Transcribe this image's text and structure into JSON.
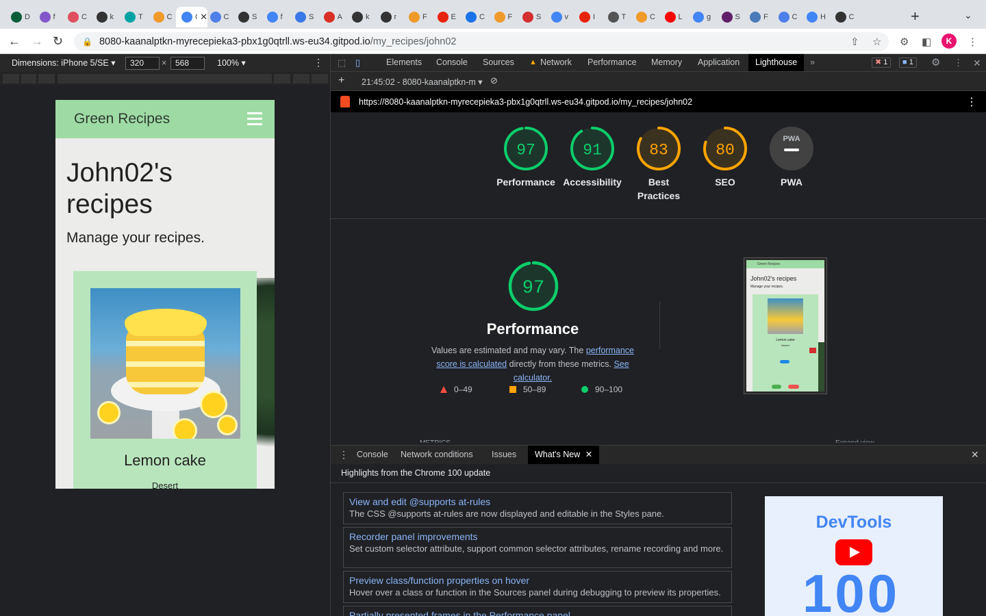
{
  "browser": {
    "tabs": [
      {
        "letter": "D",
        "color": "#0b5d3a"
      },
      {
        "letter": "f",
        "color": "#8357c9"
      },
      {
        "letter": "C",
        "color": "#e04f5f"
      },
      {
        "letter": "k",
        "color": "#333333"
      },
      {
        "letter": "T",
        "color": "#00a3a3"
      },
      {
        "letter": "C",
        "color": "#f09a2a"
      },
      {
        "letter": "G",
        "color": "#4285f4",
        "active": true
      },
      {
        "letter": "C",
        "color": "#4f7fe8"
      },
      {
        "letter": "S",
        "color": "#333333"
      },
      {
        "letter": "f",
        "color": "#4285f4"
      },
      {
        "letter": "S",
        "color": "#3b78e7"
      },
      {
        "letter": "A",
        "color": "#d93025"
      },
      {
        "letter": "k",
        "color": "#333333"
      },
      {
        "letter": "r",
        "color": "#333333"
      },
      {
        "letter": "F",
        "color": "#f09a2a"
      },
      {
        "letter": "E",
        "color": "#e8230c"
      },
      {
        "letter": "C",
        "color": "#1a73e8"
      },
      {
        "letter": "F",
        "color": "#f09a2a"
      },
      {
        "letter": "S",
        "color": "#d32f2f"
      },
      {
        "letter": "v",
        "color": "#4285f4"
      },
      {
        "letter": "I",
        "color": "#e8230c"
      },
      {
        "letter": "T",
        "color": "#555555"
      },
      {
        "letter": "C",
        "color": "#f09a2a"
      },
      {
        "letter": "L",
        "color": "#ff0000"
      },
      {
        "letter": "g",
        "color": "#4285f4"
      },
      {
        "letter": "S",
        "color": "#611f69"
      },
      {
        "letter": "F",
        "color": "#4a7ab8"
      },
      {
        "letter": "C",
        "color": "#4f7fe8"
      },
      {
        "letter": "H",
        "color": "#4285f4"
      },
      {
        "letter": "C",
        "color": "#333333"
      }
    ],
    "active_tab_letter": "G",
    "url_host": "8080-kaanalptkn-myrecepieka3-pbx1g0qtrll.ws-eu34.gitpod.io",
    "url_path": "/my_recipes/john02",
    "profile_initial": "K"
  },
  "device_toolbar": {
    "device": "Dimensions: iPhone 5/SE ▾",
    "width": "320",
    "times": "×",
    "height": "568",
    "zoom": "100% ▾"
  },
  "mobile_page": {
    "brand": "Green Recipes",
    "title": "John02's recipes",
    "subtitle": "Manage your recipes.",
    "card": {
      "title": "Lemon cake",
      "category": "Desert"
    }
  },
  "devtools": {
    "tabs": [
      "Elements",
      "Console",
      "Sources",
      "Network",
      "Performance",
      "Memory",
      "Application",
      "Lighthouse"
    ],
    "active_tab": "Lighthouse",
    "more": "»",
    "error_count": "1",
    "message_count": "1",
    "network_warning_icon": "warning-icon"
  },
  "lighthouse": {
    "report_time": "21:45:02 - 8080-kaanalptkn-m ▾",
    "report_url": "https://8080-kaanalptkn-myrecepieka3-pbx1g0qtrll.ws-eu34.gitpod.io/my_recipes/john02",
    "gauges": [
      {
        "score": "97",
        "label": "Performance",
        "value": 97,
        "color": "#0cce6b"
      },
      {
        "score": "91",
        "label": "Accessibility",
        "value": 91,
        "color": "#0cce6b"
      },
      {
        "score": "83",
        "label": "Best Practices",
        "value": 83,
        "color": "#ffa400"
      },
      {
        "score": "80",
        "label": "SEO",
        "value": 80,
        "color": "#ffa400"
      }
    ],
    "pwa": {
      "badge": "PWA",
      "label": "PWA"
    },
    "performance": {
      "score": "97",
      "value": 97,
      "title": "Performance",
      "desc_prefix": "Values are estimated and may vary. The ",
      "link1": "performance score is calculated",
      "desc_mid": " directly from these metrics. ",
      "link2": "See calculator."
    },
    "legend": [
      {
        "range": "0–49",
        "color": "#ff4e42",
        "shape": "triangle"
      },
      {
        "range": "50–89",
        "color": "#ffa400",
        "shape": "square"
      },
      {
        "range": "90–100",
        "color": "#0cce6b",
        "shape": "circle"
      }
    ],
    "cutoff_left": "METRICS",
    "cutoff_right": "Expand view",
    "thumbnail": {
      "brand": "Green Recipes",
      "title": "John02's recipes",
      "subtitle": "Manage your recipes.",
      "card_title": "Lemon cake",
      "card_cat": "Desert"
    }
  },
  "drawer": {
    "tabs": [
      "Console",
      "Network conditions",
      "Issues",
      "What's New"
    ],
    "active_tab": "What's New",
    "heading": "Highlights from the Chrome 100 update",
    "items": [
      {
        "title": "View and edit @supports at-rules",
        "desc": "The CSS @supports at-rules are now displayed and editable in the Styles pane."
      },
      {
        "title": "Recorder panel improvements",
        "desc": "Set custom selector attribute, support common selector attributes, rename recording and more."
      },
      {
        "title": "Preview class/function properties on hover",
        "desc": "Hover over a class or function in the Sources panel during debugging to preview its properties."
      },
      {
        "title": "Partially presented frames in the Performance panel",
        "desc": ""
      }
    ],
    "promo": {
      "title": "DevTools",
      "number": "100"
    }
  }
}
